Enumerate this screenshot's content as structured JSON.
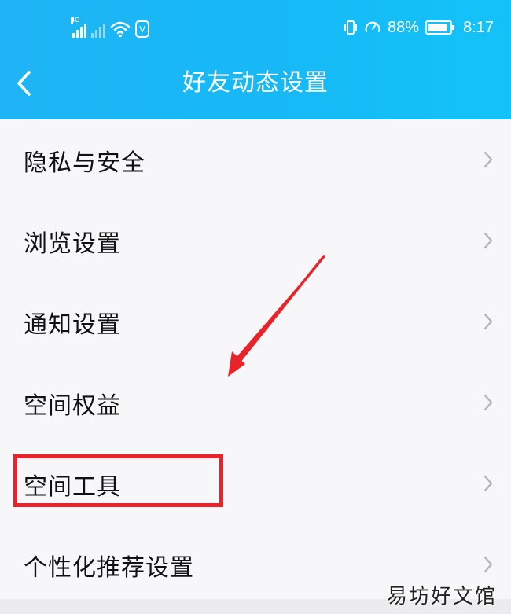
{
  "status_bar": {
    "network_tag": "4G",
    "battery_percent": 88,
    "battery_label": "88%",
    "time": "8:17",
    "vpn_label": "V"
  },
  "header": {
    "title": "好友动态设置",
    "back_icon": "chevron-left-icon"
  },
  "settings": {
    "items": [
      {
        "label": "隐私与安全",
        "chevron_icon": "chevron-right-icon"
      },
      {
        "label": "浏览设置",
        "chevron_icon": "chevron-right-icon"
      },
      {
        "label": "通知设置",
        "chevron_icon": "chevron-right-icon"
      },
      {
        "label": "空间权益",
        "chevron_icon": "chevron-right-icon"
      },
      {
        "label": "空间工具",
        "chevron_icon": "chevron-right-icon"
      },
      {
        "label": "个性化推荐设置",
        "chevron_icon": "chevron-right-icon"
      }
    ]
  },
  "annotations": {
    "highlight_color": "#e8242a",
    "highlighted_item": "空间工具"
  },
  "watermark": "易坊好文馆",
  "colors": {
    "header_start": "#1fb4f5",
    "header_end": "#13c3f8",
    "background": "#f7f7f9",
    "chevron": "#b5b5bb"
  }
}
